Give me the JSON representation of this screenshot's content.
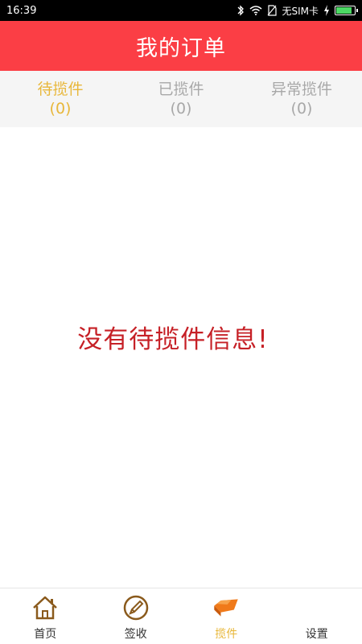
{
  "status_bar": {
    "time": "16:39",
    "carrier": "无SIM卡",
    "icons": [
      "bluetooth-icon",
      "wifi-icon",
      "nosim-icon",
      "charging-icon",
      "battery-icon"
    ]
  },
  "header": {
    "title": "我的订单"
  },
  "tabs": [
    {
      "label": "待揽件",
      "count": "(0)",
      "active": true
    },
    {
      "label": "已揽件",
      "count": "(0)",
      "active": false
    },
    {
      "label": "异常揽件",
      "count": "(0)",
      "active": false
    }
  ],
  "content": {
    "empty_message": "没有待揽件信息!"
  },
  "bottom_nav": {
    "items": [
      {
        "label": "首页",
        "icon": "home-icon",
        "active": false
      },
      {
        "label": "签收",
        "icon": "sign-icon",
        "active": false
      },
      {
        "label": "揽件",
        "icon": "pickup-icon",
        "active": true
      },
      {
        "label": "设置",
        "icon": "settings-icon",
        "active": false
      }
    ]
  },
  "colors": {
    "header_bg": "#fb3e45",
    "active_tab": "#e8b73a",
    "inactive_tab": "#a8a8a8",
    "empty_message": "#c62026",
    "nav_icon_brown": "#8a5a1c",
    "nav_icon_orange": "#f07a1a"
  }
}
